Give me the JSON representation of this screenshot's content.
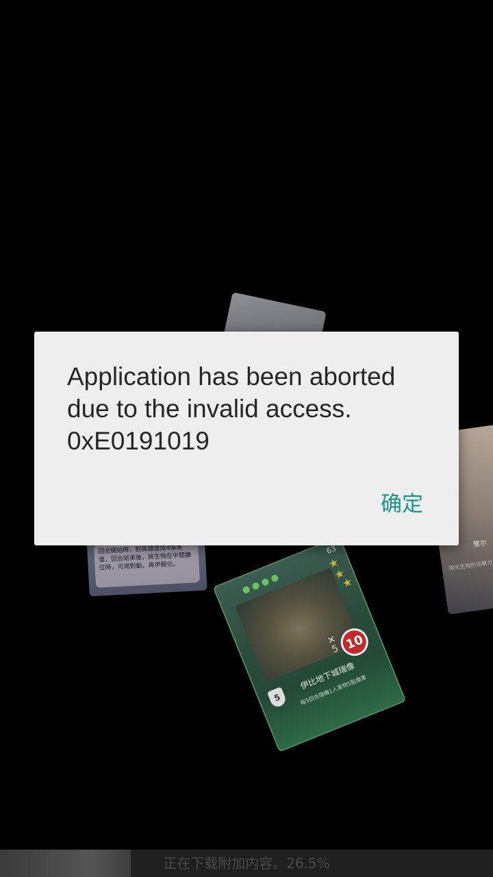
{
  "dialog": {
    "message": "Application has been aborted\ndue to the invalid access.\n0xE0191019",
    "ok_label": "确定",
    "ok_color": "#17978f"
  },
  "background_cards": {
    "left_card": {
      "text": "回合開始時，對英雄造成4傷害值，回合結束後，將生物在中間擴位時，可用對動，再伊擬化。"
    },
    "right_card": {
      "name": "雙尔",
      "text": "除光生物的攻擊力大量"
    },
    "bottom_card": {
      "level": "63",
      "attack": "10",
      "multiplier": "5",
      "shield": "5",
      "name": "伊比地下城瑞像",
      "description": "每5回合隨機1人某物5點傷害"
    }
  },
  "download": {
    "text": "正在下载附加内容。26.5%",
    "progress_percent": 26.5
  }
}
